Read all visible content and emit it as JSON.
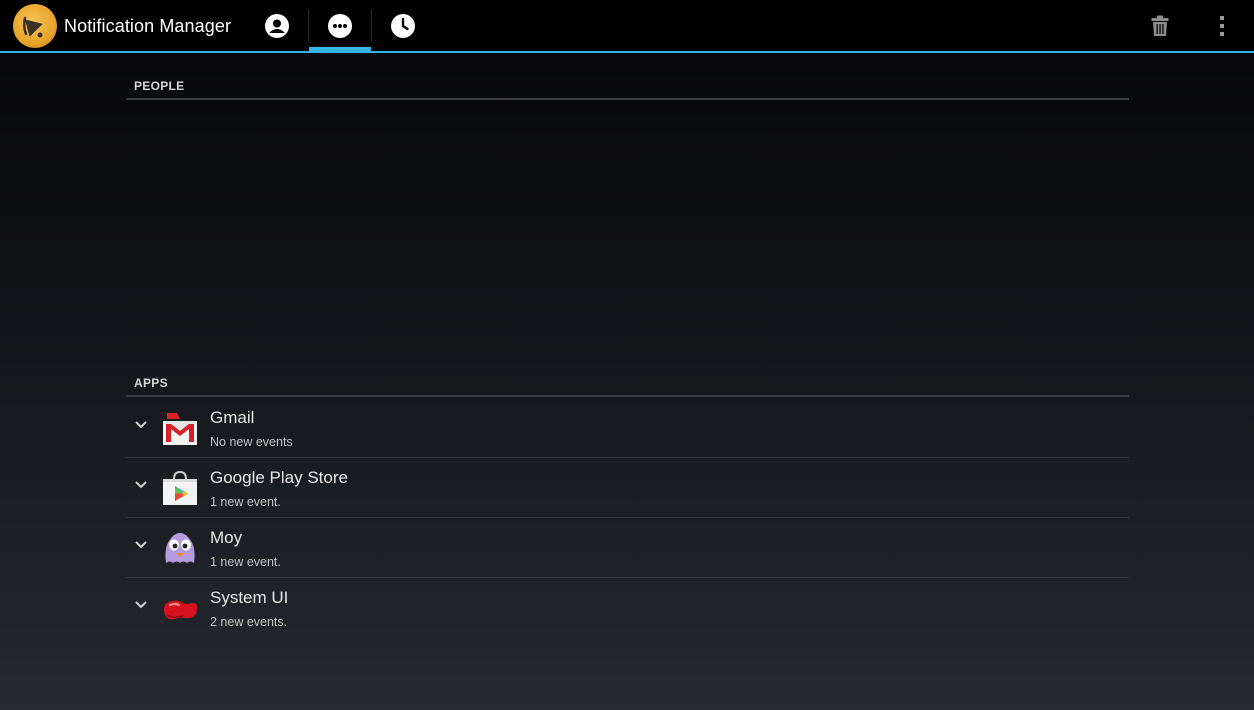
{
  "actionbar": {
    "title": "Notification Manager",
    "accent_color": "#33b5e5",
    "logo_icon": "bell-logo-icon",
    "tabs": [
      {
        "name": "people",
        "icon": "person-icon",
        "selected": false
      },
      {
        "name": "events",
        "icon": "more-dots-icon",
        "selected": true
      },
      {
        "name": "history",
        "icon": "clock-icon",
        "selected": false
      }
    ],
    "actions": [
      {
        "name": "delete",
        "icon": "trash-icon"
      },
      {
        "name": "overflow",
        "icon": "overflow-menu-icon"
      }
    ]
  },
  "sections": {
    "people": {
      "label": "PEOPLE"
    },
    "apps": {
      "label": "APPS",
      "items": [
        {
          "name": "Gmail",
          "status": "No new events",
          "icon": "gmail-icon"
        },
        {
          "name": "Google Play Store",
          "status": "1 new event.",
          "icon": "play-store-icon"
        },
        {
          "name": "Moy",
          "status": "1 new event.",
          "icon": "moy-icon"
        },
        {
          "name": "System UI",
          "status": "2 new events.",
          "icon": "jellybean-icon"
        }
      ]
    }
  }
}
